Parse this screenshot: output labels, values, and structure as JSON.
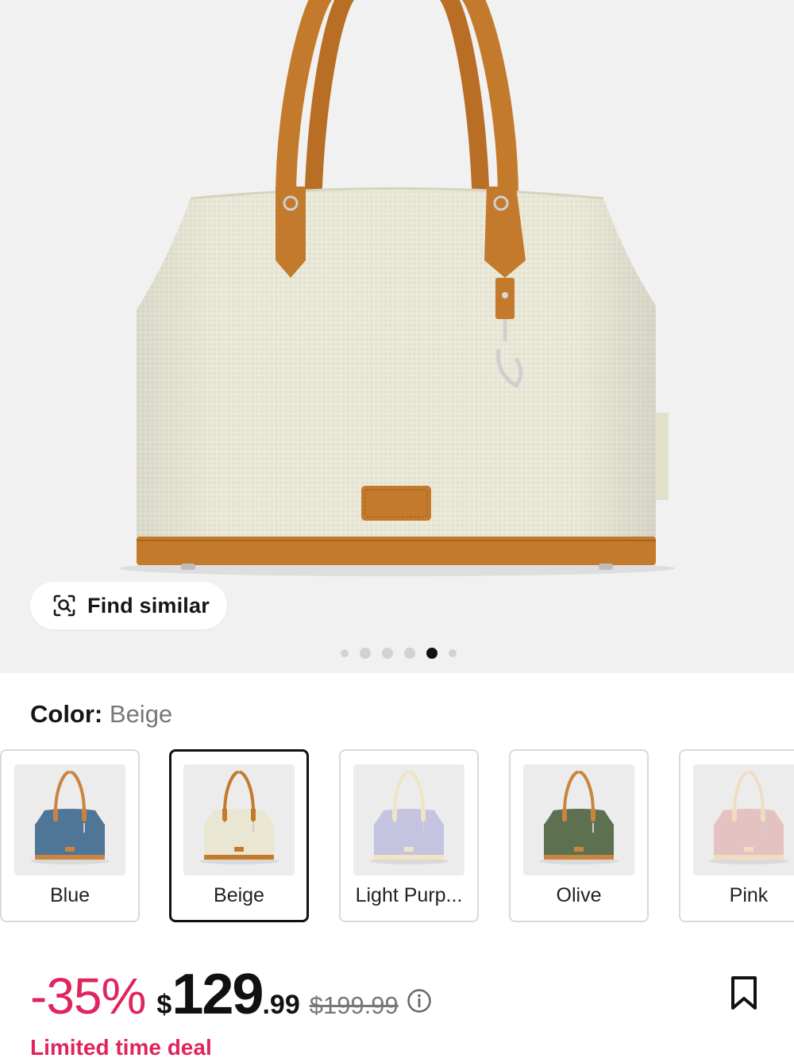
{
  "hero": {
    "find_similar_label": "Find similar",
    "carousel": {
      "count": 6,
      "active_index": 4
    }
  },
  "color": {
    "heading_key": "Color:",
    "selected_value": "Beige",
    "options": [
      {
        "label": "Blue",
        "body_color": "#4f7597",
        "trim_color": "#c9843f",
        "selected": false
      },
      {
        "label": "Beige",
        "body_color": "#e9e6d2",
        "trim_color": "#c47a2c",
        "selected": true
      },
      {
        "label": "Light Purp...",
        "body_color": "#c4c3e0",
        "trim_color": "#efe4c6",
        "selected": false
      },
      {
        "label": "Olive",
        "body_color": "#5d7151",
        "trim_color": "#c9843f",
        "selected": false
      },
      {
        "label": "Pink",
        "body_color": "#e4c2c1",
        "trim_color": "#f1dcc2",
        "selected": false
      }
    ]
  },
  "price": {
    "discount": "-35%",
    "currency": "$",
    "integer": "129",
    "decimal": ".99",
    "original": "$199.99"
  },
  "deal_label": "Limited time deal",
  "icons": {
    "find_similar": "image-search-icon",
    "info": "info-icon",
    "bookmark": "bookmark-icon"
  },
  "colors": {
    "accent": "#e0245e",
    "hero_bg": "#f1f1f1",
    "leather": "#c47a2c"
  }
}
